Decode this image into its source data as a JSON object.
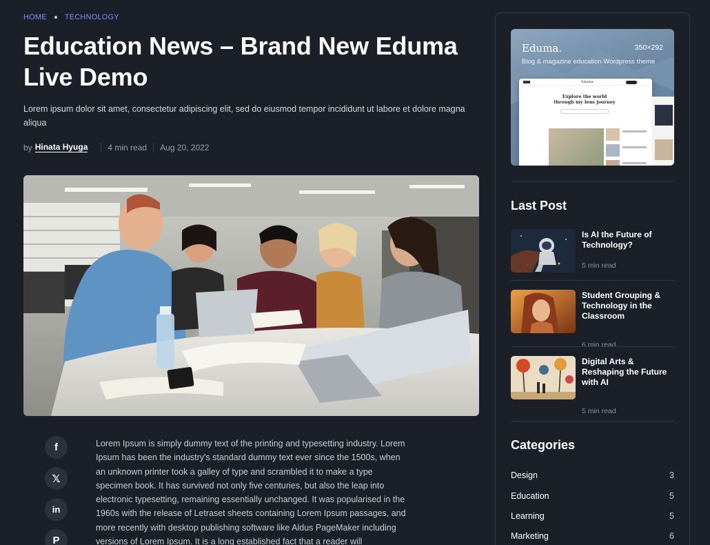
{
  "breadcrumb": {
    "home": "HOME",
    "category": "TECHNOLOGY"
  },
  "article": {
    "title": "Education News – Brand New Eduma Live Demo",
    "excerpt": "Lorem ipsum dolor sit amet, consectetur adipiscing elit, sed do eiusmod tempor incididunt ut labore et dolore magna aliqua",
    "by_label": "by",
    "author": "Hinata Hyuga",
    "read_time": "4 min read",
    "date": "Aug 20, 2022",
    "body": "Lorem Ipsum is simply dummy text of the printing and typesetting industry. Lorem Ipsum has been the industry's standard dummy text ever since the 1500s, when an unknown printer took a galley of type and scrambled it to make a type specimen book. It has survived not only five centuries, but also the leap into electronic typesetting, remaining essentially unchanged. It was popularised in the 1960s with the release of Letraset sheets containing Lorem Ipsum passages, and more recently with desktop publishing software like Aldus PageMaker including versions of Lorem Ipsum. It is a long established fact that a reader will"
  },
  "share": [
    {
      "icon": "facebook-icon",
      "glyph": "f"
    },
    {
      "icon": "x-twitter-icon",
      "glyph": "𝕏"
    },
    {
      "icon": "linkedin-icon",
      "glyph": "in"
    },
    {
      "icon": "pinterest-icon",
      "glyph": "P"
    }
  ],
  "sidebar": {
    "ad": {
      "logo": "Eduma.",
      "size": "350×292",
      "tagline": "Blog & magazine education Wordpress theme",
      "screen_heading": "Explore the world through my lens journey",
      "screen_brand": "Eduma"
    },
    "last_post_title": "Last Post",
    "posts": [
      {
        "title": "Is AI the Future of Technology?",
        "read": "5 min read"
      },
      {
        "title": "Student Grouping & Technology in the Classroom",
        "read": "6 min read"
      },
      {
        "title": "Digital Arts & Reshaping the Future with AI",
        "read": "5 min read"
      }
    ],
    "categories_title": "Categories",
    "categories": [
      {
        "name": "Design",
        "count": "3"
      },
      {
        "name": "Education",
        "count": "5"
      },
      {
        "name": "Learning",
        "count": "5"
      },
      {
        "name": "Marketing",
        "count": "6"
      }
    ]
  },
  "colors": {
    "background": "#1b1f27",
    "accent": "#7b8cff",
    "card_border": "#323844"
  }
}
